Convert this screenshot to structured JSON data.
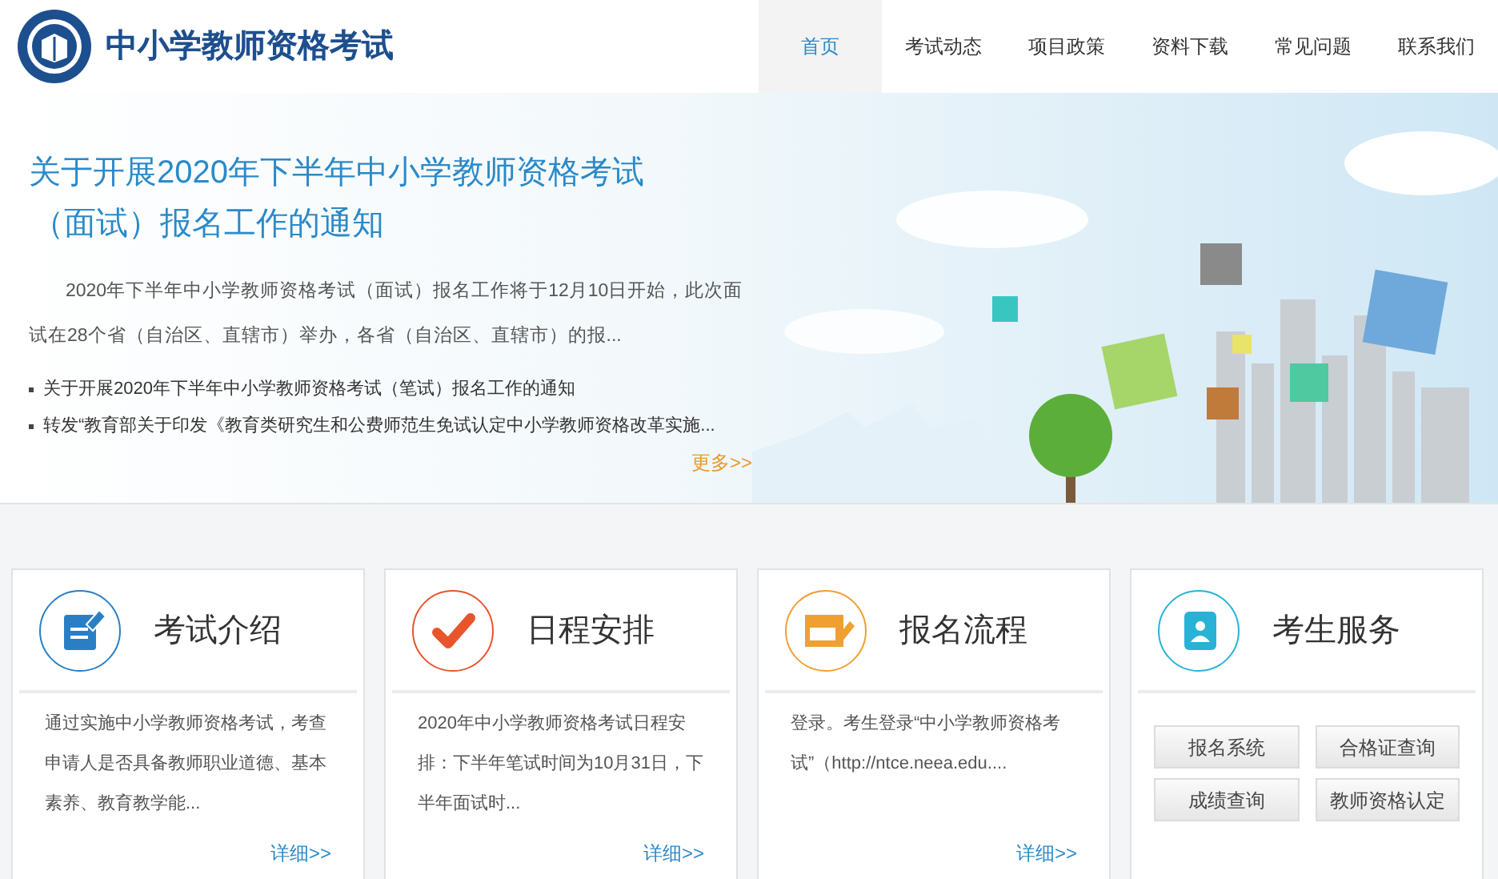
{
  "header": {
    "site_title": "中小学教师资格考试",
    "nav": [
      {
        "label": "首页",
        "selected": true
      },
      {
        "label": "考试动态",
        "selected": false
      },
      {
        "label": "项目政策",
        "selected": false
      },
      {
        "label": "资料下载",
        "selected": false
      },
      {
        "label": "常见问题",
        "selected": false
      },
      {
        "label": "联系我们",
        "selected": false
      }
    ]
  },
  "banner": {
    "headline_lines": [
      "关于开展2020年下半年中小学教师资格考试",
      "（面试）报名工作的通知"
    ],
    "summary": "2020年下半年中小学教师资格考试（面试）报名工作将于12月10日开始，此次面试在28个省（自治区、直辖市）举办，各省（自治区、直辖市）的报...",
    "links": [
      "关于开展2020年下半年中小学教师资格考试（笔试）报名工作的通知",
      "转发“教育部关于印发《教育类研究生和公费师范生免试认定中小学教师资格改革实施..."
    ],
    "more": "更多>>"
  },
  "cards": [
    {
      "kind": "article",
      "color": "#2a7fc4",
      "title": "考试介绍",
      "body": "通过实施中小学教师资格考试，考查申请人是否具备教师职业道德、基本素养、教育教学能...",
      "more": "详细>>"
    },
    {
      "kind": "article",
      "color": "#e8552d",
      "title": "日程安排",
      "body": "2020年中小学教师资格考试日程安排：下半年笔试时间为10月31日，下半年面试时...",
      "more": "详细>>"
    },
    {
      "kind": "article",
      "color": "#f0a030",
      "title": "报名流程",
      "body": "登录。考生登录“中小学教师资格考试”（http://ntce.neea.edu....",
      "more": "详细>>"
    },
    {
      "kind": "services",
      "color": "#29b2d6",
      "title": "考生服务",
      "buttons": [
        "报名系统",
        "合格证查询",
        "成绩查询",
        "教师资格认定"
      ]
    }
  ]
}
